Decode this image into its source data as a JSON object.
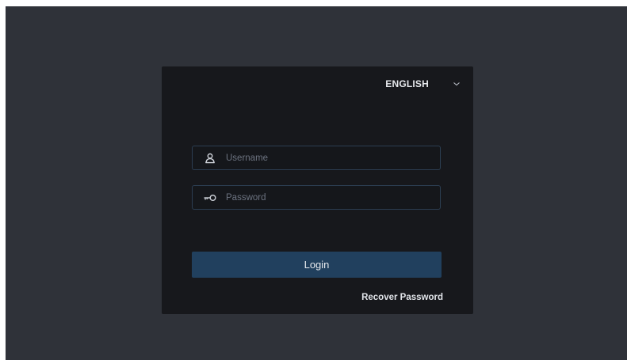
{
  "language_selector": {
    "selected": "ENGLISH",
    "icon": "chevron-down-icon"
  },
  "form": {
    "username": {
      "value": "",
      "placeholder": "Username",
      "icon": "user-icon"
    },
    "password": {
      "value": "",
      "placeholder": "Password",
      "icon": "key-icon"
    },
    "login_label": "Login",
    "recover_label": "Recover Password"
  },
  "colors": {
    "background": "#2f3239",
    "card": "#17181c",
    "field_border": "#2c3e52",
    "button": "#21405e",
    "text": "#e6e8ec",
    "placeholder": "#6c7380"
  }
}
